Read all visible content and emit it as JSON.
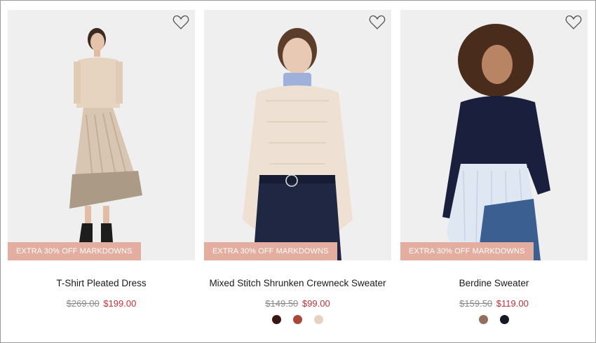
{
  "products": [
    {
      "promo": "EXTRA 30% OFF MARKDOWNS",
      "name": "T-Shirt Pleated Dress",
      "old_price": "$269.00",
      "new_price": "$199.00",
      "swatches": [],
      "wishlist_icon": "heart-outline-icon"
    },
    {
      "promo": "EXTRA 30% OFF MARKDOWNS",
      "name": "Mixed Stitch Shrunken Crewneck Sweater",
      "old_price": "$149.50",
      "new_price": "$99.00",
      "swatches": [
        "#3a1613",
        "#a8473a",
        "#e6d2c3"
      ],
      "wishlist_icon": "heart-outline-icon"
    },
    {
      "promo": "EXTRA 30% OFF MARKDOWNS",
      "name": "Berdine Sweater",
      "old_price": "$159.50",
      "new_price": "$119.00",
      "swatches": [
        "#93705e",
        "#141a24"
      ],
      "wishlist_icon": "heart-outline-icon"
    }
  ],
  "colors": {
    "promo_bg": "#e3ae9f",
    "sale_price": "#c0303a",
    "old_price": "#8a8a8a",
    "photo_bg": "#efefef"
  }
}
